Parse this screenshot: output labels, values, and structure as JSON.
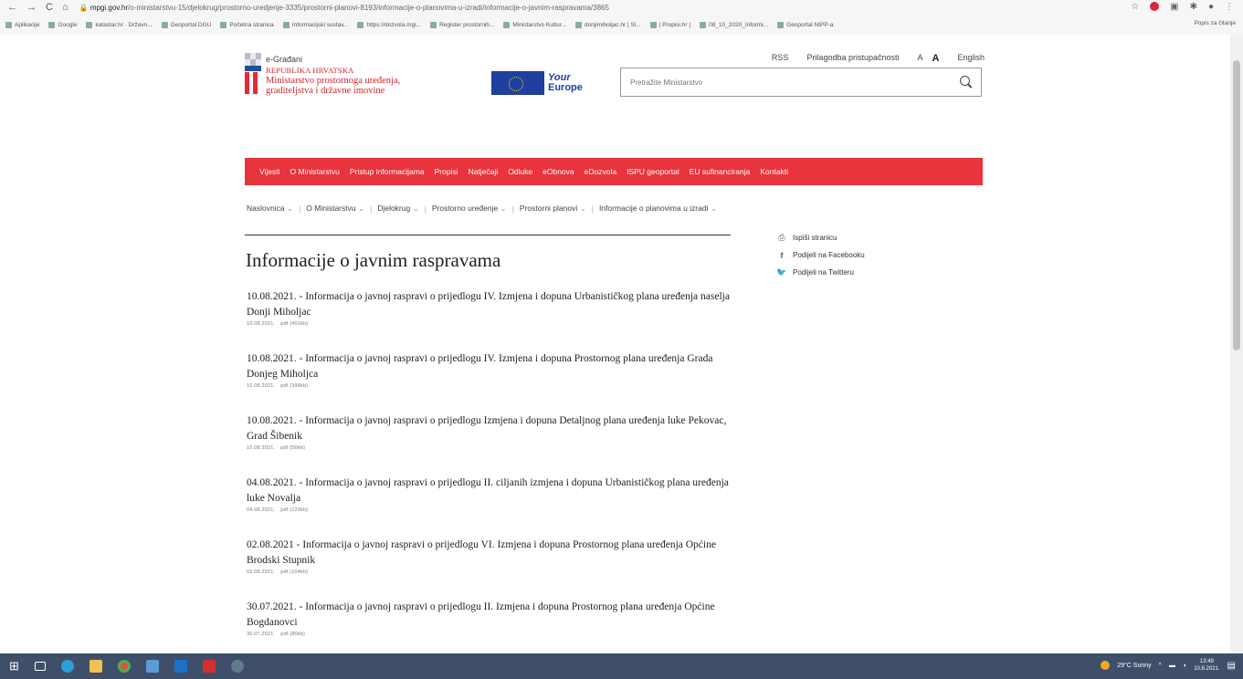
{
  "browser": {
    "url_domain": "mpgi.gov.hr",
    "url_path": "/o-ministarstvu-15/djelokrug/prostorno-uredjenje-3335/prostorni-planovi-8193/informacije-o-planovima-u-izradi/informacije-o-javnim-raspravama/3865",
    "back_icon": "←",
    "forward_icon": "→",
    "reload_icon": "C",
    "home_icon": "⌂",
    "lock_icon": "🔒"
  },
  "bookmarks": {
    "items": [
      "Aplikacije",
      "Google",
      "katastar.hr · Državn...",
      "Geoportal DGU",
      "Početna stranica",
      "Informacijski sustav...",
      "https://dozvola.mgi...",
      "Register prostornih...",
      "Ministarstvo Kultur...",
      "donjimiholjac.hr | Sl...",
      "| Propisi.hr |",
      "08_10_2020_Informi...",
      "Geoportal NIPP-a"
    ],
    "reading_list": "Popis za čitanje"
  },
  "header": {
    "egradani": "e-Građani",
    "rss": "RSS",
    "accessibility": "Prilagodba pristupačnosti",
    "font_small": "A",
    "font_large": "A",
    "english": "English"
  },
  "logo": {
    "line1": "REPUBLIKA HRVATSKA",
    "line2": "Ministarstvo prostornoga uređenja,",
    "line3": "graditeljstva i državne imovine"
  },
  "eu": {
    "your": "Your",
    "europe": "Europe"
  },
  "search": {
    "placeholder": "Pretražite Ministarstvo"
  },
  "mainnav": [
    "Vijesti",
    "O Ministarstvu",
    "Pristup informacijama",
    "Propisi",
    "Natječaji",
    "Odluke",
    "eObnova",
    "eDozvola",
    "ISPU geoportal",
    "EU sufinanciranja",
    "Kontakti"
  ],
  "breadcrumb": [
    "Naslovnica",
    "O Ministarstvu",
    "Djelokrug",
    "Prostorno uređenje",
    "Prostorni planovi",
    "Informacije o planovima u izradi"
  ],
  "page": {
    "title": "Informacije o javnim raspravama"
  },
  "share": {
    "print": "Ispiši stranicu",
    "facebook": "Podijeli na Facebooku",
    "twitter": "Podijeli na Twitteru"
  },
  "items": [
    {
      "title": "10.08.2021. - Informacija o javnoj raspravi o prijedlogu IV. Izmjena i dopuna Urbanističkog plana uređenja naselja Donji Miholjac",
      "date": "10.08.2021.",
      "file": "pdf (401kb)"
    },
    {
      "title": "10.08.2021. - Informacija o javnoj raspravi o prijedlogu IV. Izmjena i dopuna Prostornog plana uređenja Grada Donjeg Miholjca",
      "date": "10.08.2021.",
      "file": "pdf (398kb)"
    },
    {
      "title": "10.08.2021. - Informacija o javnoj raspravi o prijedlogu Izmjena i dopuna Detaljnog plana uređenja luke Pekovac, Grad Šibenik",
      "date": "10.08.2021.",
      "file": "pdf (56kb)"
    },
    {
      "title": "04.08.2021. - Informacija o javnoj raspravi o prijedlogu II. ciljanih izmjena i dopuna Urbanističkog plana uređenja luke Novalja",
      "date": "04.08.2021.",
      "file": "pdf (120kb)"
    },
    {
      "title": "02.08.2021 - Informacija o javnoj raspravi o prijedlogu VI. Izmjena i dopuna Prostornog plana uređenja Općine Brodski Stupnik",
      "date": "02.08.2021.",
      "file": "pdf (104kb)"
    },
    {
      "title": "30.07.2021. - Informacija o javnoj raspravi o prijedlogu II. Izmjena i dopuna Prostornog plana uređenja Općine Bogdanovci",
      "date": "30.07.2021.",
      "file": "pdf (80kb)"
    }
  ],
  "taskbar": {
    "weather": "29°C Sunny",
    "time": "13:49",
    "date": "10.8.2021."
  },
  "colors": {
    "nav_red": "#e8343d",
    "logo_red": "#d2232a",
    "eu_blue": "#1f3fa0",
    "taskbar": "#3f4f6a"
  }
}
